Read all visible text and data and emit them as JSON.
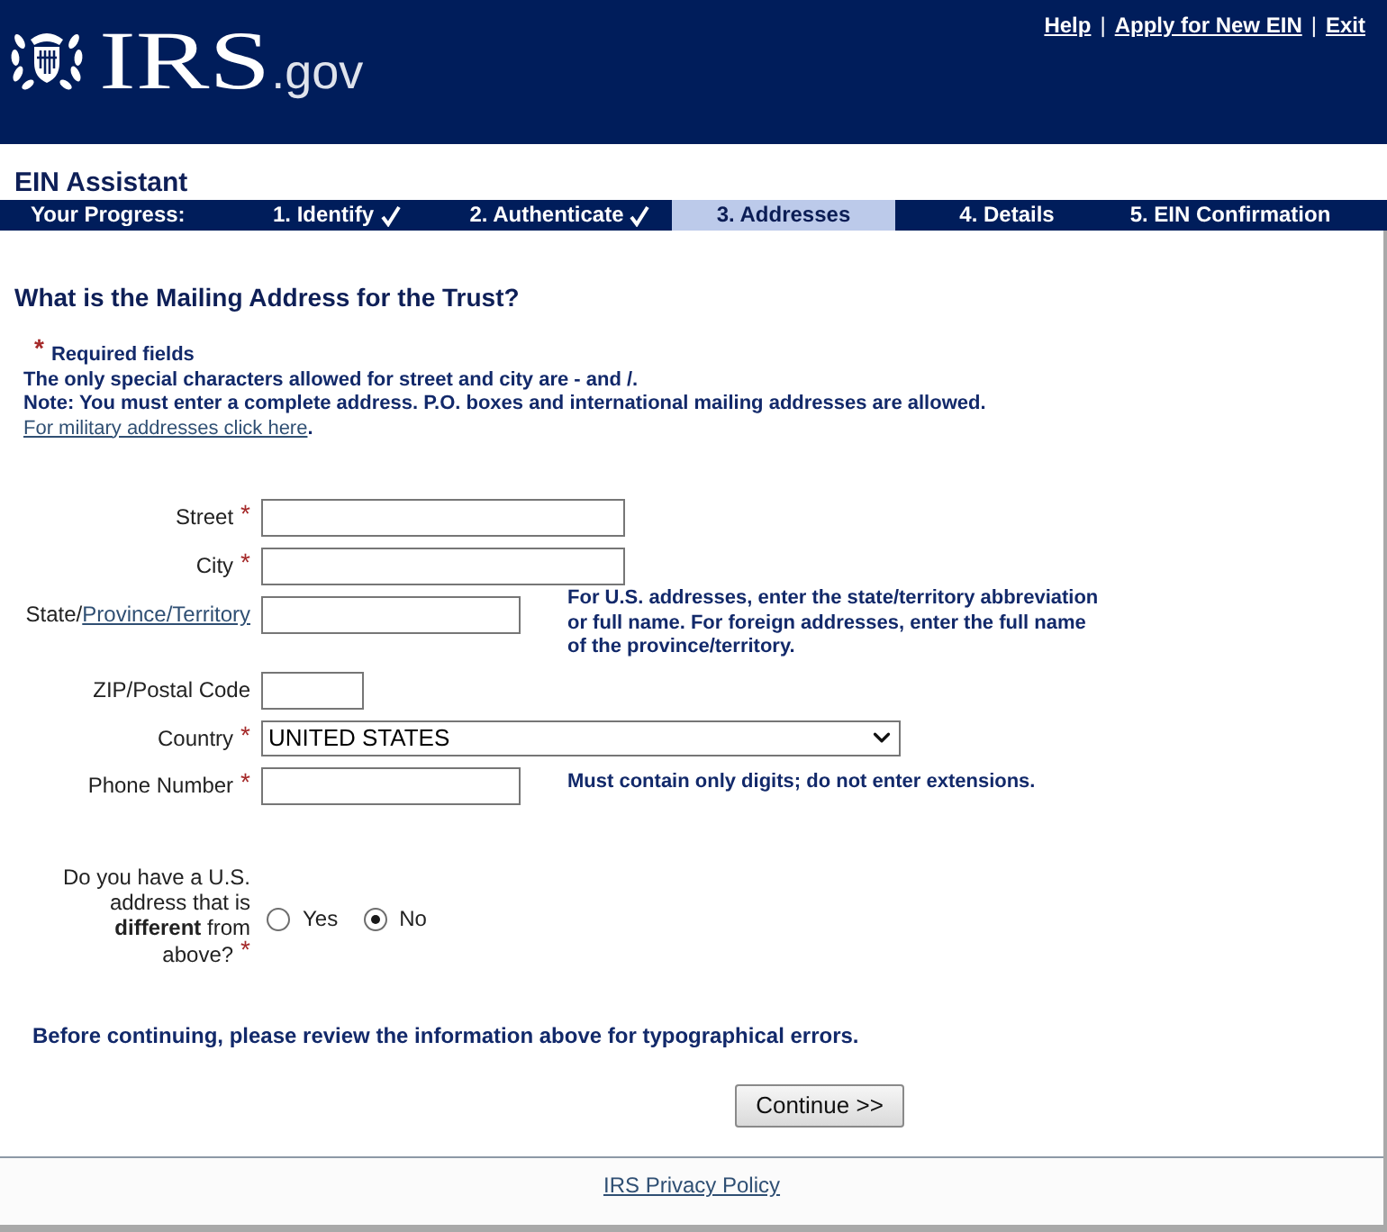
{
  "header": {
    "logo_text": "IRS",
    "logo_suffix": ".gov",
    "top_links": [
      {
        "kind": "link",
        "text": "Help"
      },
      {
        "kind": "separator",
        "text": "|"
      },
      {
        "kind": "link",
        "text": "Apply for New EIN"
      },
      {
        "kind": "separator",
        "text": "|"
      },
      {
        "kind": "link",
        "text": "Exit"
      }
    ]
  },
  "app_title": "EIN Assistant",
  "progress": {
    "label": "Your Progress:",
    "steps": [
      {
        "label": "1. Identify",
        "completed": true,
        "selected": false
      },
      {
        "label": "2. Authenticate",
        "completed": true,
        "selected": false
      },
      {
        "label": "3. Addresses",
        "completed": false,
        "selected": true
      },
      {
        "label": "4. Details",
        "completed": false,
        "selected": false
      },
      {
        "label": "5. EIN Confirmation",
        "completed": false,
        "selected": false
      }
    ]
  },
  "heading": "What is the Mailing Address for the Trust?",
  "notes": {
    "required_mark": "*",
    "required_label": "Required fields",
    "lines": [
      "The only special characters allowed for street and city are - and /.",
      "Note: You must enter a complete address. P.O. boxes and international mailing addresses are allowed."
    ],
    "military_link": "For military addresses click here",
    "military_suffix": "."
  },
  "fields": [
    {
      "kind": "text",
      "label": "Street",
      "required_mark": "*"
    },
    {
      "kind": "text",
      "label": "City",
      "required_mark": "*"
    },
    {
      "kind": "text",
      "label": "State/",
      "label_link": "Province/Territory",
      "hint": "For U.S. addresses, enter the state/territory abbreviation or full name. For foreign addresses, enter the full name of the province/territory."
    },
    {
      "kind": "text",
      "label": "ZIP/Postal Code"
    },
    {
      "kind": "select",
      "label": "Country",
      "required_mark": "*",
      "value": "UNITED STATES"
    },
    {
      "kind": "text",
      "label": "Phone Number",
      "required_mark": "*",
      "hint": "Must contain only digits; do not enter extensions."
    }
  ],
  "question": {
    "text": "Do you have a U.S. address that is **different** from above?",
    "required_mark": "*",
    "options": [
      {
        "label": "Yes",
        "selected": false
      },
      {
        "label": "No",
        "selected": true
      }
    ]
  },
  "review_note": "Before continuing, please review the information above for typographical errors.",
  "continue_button": "Continue >>",
  "footer": {
    "link": "IRS Privacy Policy"
  }
}
